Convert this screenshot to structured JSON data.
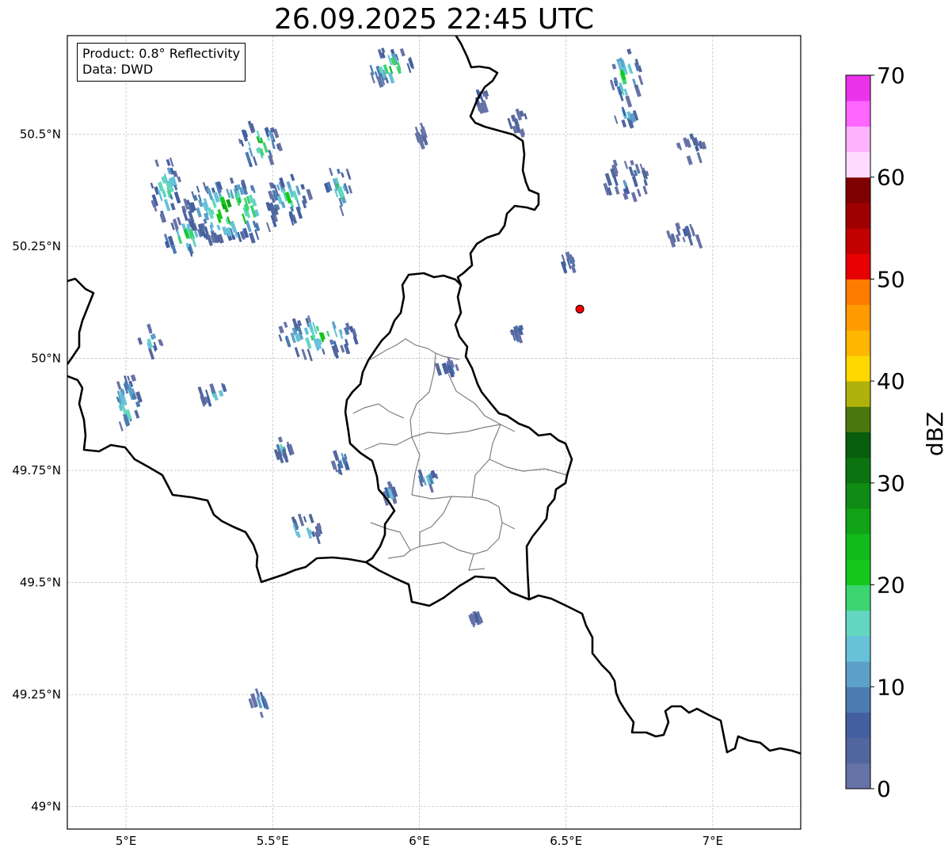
{
  "title": "26.09.2025 22:45 UTC",
  "info": {
    "product_line": "Product: 0.8° Reflectivity",
    "data_line": "Data: DWD"
  },
  "map": {
    "lon_range": [
      4.8,
      7.3
    ],
    "lat_range": [
      48.95,
      50.72
    ],
    "lon_ticks": [
      {
        "value": 5.0,
        "label": "5°E"
      },
      {
        "value": 5.5,
        "label": "5.5°E"
      },
      {
        "value": 6.0,
        "label": "6°E"
      },
      {
        "value": 6.5,
        "label": "6.5°E"
      },
      {
        "value": 7.0,
        "label": "7°E"
      }
    ],
    "lat_ticks": [
      {
        "value": 49.0,
        "label": "49°N"
      },
      {
        "value": 49.25,
        "label": "49.25°N"
      },
      {
        "value": 49.5,
        "label": "49.5°N"
      },
      {
        "value": 49.75,
        "label": "49.75°N"
      },
      {
        "value": 50.0,
        "label": "50°N"
      },
      {
        "value": 50.25,
        "label": "50.25°N"
      },
      {
        "value": 50.5,
        "label": "50.5°N"
      }
    ],
    "grid": "dashed",
    "radar_site": {
      "lon": 6.547,
      "lat": 50.11,
      "color": "#ff0000"
    },
    "echo_cells": [
      {
        "lon": 5.35,
        "lat": 50.33,
        "rx": 0.16,
        "ry": 0.07,
        "peak_dbz": 32
      },
      {
        "lon": 5.2,
        "lat": 50.27,
        "rx": 0.08,
        "ry": 0.04,
        "peak_dbz": 30
      },
      {
        "lon": 5.45,
        "lat": 50.48,
        "rx": 0.07,
        "ry": 0.05,
        "peak_dbz": 28
      },
      {
        "lon": 5.55,
        "lat": 50.36,
        "rx": 0.07,
        "ry": 0.05,
        "peak_dbz": 26
      },
      {
        "lon": 5.13,
        "lat": 50.38,
        "rx": 0.05,
        "ry": 0.07,
        "peak_dbz": 25
      },
      {
        "lon": 5.72,
        "lat": 50.38,
        "rx": 0.05,
        "ry": 0.05,
        "peak_dbz": 25
      },
      {
        "lon": 5.9,
        "lat": 50.65,
        "rx": 0.08,
        "ry": 0.04,
        "peak_dbz": 30
      },
      {
        "lon": 5.65,
        "lat": 50.05,
        "rx": 0.14,
        "ry": 0.04,
        "peak_dbz": 27
      },
      {
        "lon": 5.08,
        "lat": 50.04,
        "rx": 0.04,
        "ry": 0.03,
        "peak_dbz": 22
      },
      {
        "lon": 5.0,
        "lat": 49.9,
        "rx": 0.05,
        "ry": 0.06,
        "peak_dbz": 26
      },
      {
        "lon": 5.3,
        "lat": 49.92,
        "rx": 0.06,
        "ry": 0.02,
        "peak_dbz": 20
      },
      {
        "lon": 5.6,
        "lat": 49.62,
        "rx": 0.06,
        "ry": 0.03,
        "peak_dbz": 26
      },
      {
        "lon": 5.53,
        "lat": 49.8,
        "rx": 0.03,
        "ry": 0.02,
        "peak_dbz": 18
      },
      {
        "lon": 5.73,
        "lat": 49.77,
        "rx": 0.03,
        "ry": 0.03,
        "peak_dbz": 18
      },
      {
        "lon": 6.02,
        "lat": 49.73,
        "rx": 0.04,
        "ry": 0.02,
        "peak_dbz": 20
      },
      {
        "lon": 5.89,
        "lat": 49.7,
        "rx": 0.02,
        "ry": 0.02,
        "peak_dbz": 20
      },
      {
        "lon": 6.09,
        "lat": 49.98,
        "rx": 0.04,
        "ry": 0.015,
        "peak_dbz": 14
      },
      {
        "lon": 5.45,
        "lat": 49.23,
        "rx": 0.03,
        "ry": 0.03,
        "peak_dbz": 20
      },
      {
        "lon": 6.19,
        "lat": 49.42,
        "rx": 0.02,
        "ry": 0.008,
        "peak_dbz": 12
      },
      {
        "lon": 6.7,
        "lat": 50.63,
        "rx": 0.05,
        "ry": 0.06,
        "peak_dbz": 30
      },
      {
        "lon": 6.7,
        "lat": 50.54,
        "rx": 0.04,
        "ry": 0.02,
        "peak_dbz": 25
      },
      {
        "lon": 6.7,
        "lat": 50.4,
        "rx": 0.08,
        "ry": 0.04,
        "peak_dbz": 16
      },
      {
        "lon": 6.9,
        "lat": 50.28,
        "rx": 0.06,
        "ry": 0.025,
        "peak_dbz": 10
      },
      {
        "lon": 6.92,
        "lat": 50.47,
        "rx": 0.05,
        "ry": 0.03,
        "peak_dbz": 10
      },
      {
        "lon": 6.5,
        "lat": 50.21,
        "rx": 0.03,
        "ry": 0.02,
        "peak_dbz": 16
      },
      {
        "lon": 6.33,
        "lat": 50.06,
        "rx": 0.02,
        "ry": 0.015,
        "peak_dbz": 14
      },
      {
        "lon": 6.2,
        "lat": 50.58,
        "rx": 0.04,
        "ry": 0.02,
        "peak_dbz": 12
      },
      {
        "lon": 6.33,
        "lat": 50.53,
        "rx": 0.04,
        "ry": 0.03,
        "peak_dbz": 10
      },
      {
        "lon": 6.0,
        "lat": 50.5,
        "rx": 0.02,
        "ry": 0.02,
        "peak_dbz": 8
      }
    ]
  },
  "colorbar": {
    "label": "dBZ",
    "min": 0,
    "max": 70,
    "step": 2.5,
    "tick_values": [
      0,
      10,
      20,
      30,
      40,
      50,
      60,
      70
    ],
    "tick_labels": [
      "0",
      "10",
      "20",
      "30",
      "40",
      "50",
      "60",
      "70"
    ],
    "colors": [
      "#6673a6",
      "#52669e",
      "#435fa0",
      "#4c7bb1",
      "#5da0c8",
      "#66c1d9",
      "#62d6c0",
      "#3cd572",
      "#14c91b",
      "#12bb19",
      "#10a316",
      "#0e8c13",
      "#0b7410",
      "#085e0c",
      "#4a780c",
      "#b0b20b",
      "#ffd800",
      "#ffb600",
      "#ff9a00",
      "#ff7c00",
      "#e60000",
      "#c10000",
      "#9e0000",
      "#7e0000",
      "#ffdbff",
      "#ffb3ff",
      "#ff66ff",
      "#ec33ec"
    ]
  }
}
